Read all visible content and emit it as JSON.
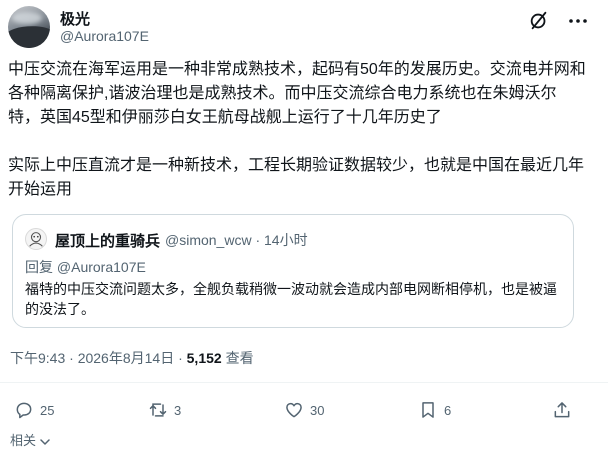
{
  "author": {
    "display_name": "极光",
    "handle": "@Aurora107E"
  },
  "post": {
    "text": "中压交流在海军运用是一种非常成熟技术，起码有50年的发展历史。交流电并网和各种隔离保护,谐波治理也是成熟技术。而中压交流综合电力系统也在朱姆沃尔特，英国45型和伊丽莎白女王航母战舰上运行了十几年历史了\n\n实际上中压直流才是一种新技术，工程长期验证数据较少，也就是中国在最近几年开始运用"
  },
  "quote": {
    "display_name": "屋顶上的重骑兵",
    "handle_time": "@simon_wcw · 14小时",
    "reply_to": "回复 @Aurora107E",
    "text": "福特的中压交流问题太多，全舰负载稍微一波动就会造成内部电网断相停机，也是被逼的没法了。"
  },
  "meta": {
    "timestamp": "下午9:43 · 2026年8月14日 · ",
    "views_count": "5,152",
    "views_label": " 查看"
  },
  "actions": {
    "replies": "25",
    "reposts": "3",
    "likes": "30",
    "bookmarks": "6"
  },
  "footer": {
    "related_label": "相关"
  },
  "icons": [
    "grok-icon",
    "more-icon",
    "reply-icon",
    "repost-icon",
    "like-icon",
    "bookmark-icon",
    "share-icon",
    "chevron-down-icon"
  ],
  "colors": {
    "text": "#0f1419",
    "secondary": "#536471",
    "border": "#cfd9de"
  }
}
